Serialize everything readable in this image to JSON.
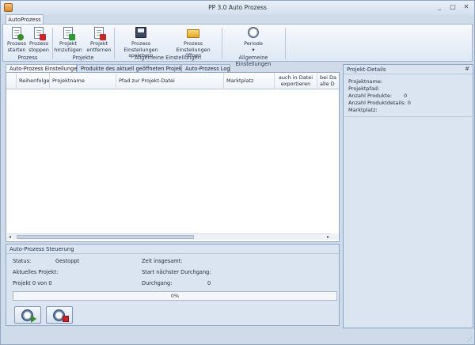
{
  "window": {
    "title": "PP 3.0 Auto Prozess"
  },
  "ribbon": {
    "tab": "AutoProzess",
    "groups": [
      {
        "label": "Prozess",
        "buttons": [
          "Prozess starten",
          "Prozess stoppen"
        ]
      },
      {
        "label": "Projekte",
        "buttons": [
          "Projekt hinzufügen",
          "Projekt entfernen"
        ]
      },
      {
        "label": "Allgemeine Einstellungen",
        "buttons": [
          "Prozess Einstellungen speichern",
          "Prozess Einstellungen öffnen"
        ]
      },
      {
        "label": "Allgemeine Einstellungen",
        "buttons": [
          "Periode"
        ]
      }
    ]
  },
  "tabs": [
    "Auto-Prozess Einstellungen",
    "Produkte des aktuell geöffneten Projekts",
    "Auto-Prozess Log"
  ],
  "grid": {
    "columns": [
      "",
      "Reihenfolge",
      "Projektname",
      "Pfad zur Projekt-Datei",
      "Marktplatz",
      "auch in Datei exportieren",
      "bei Da alle D"
    ]
  },
  "control": {
    "title": "Auto-Prozess Steuerung",
    "status_label": "Status:",
    "status_value": "Gestoppt",
    "current_label": "Aktuelles Projekt:",
    "project_count": "Projekt 0 von 0",
    "total_time_label": "Zeit insgesamt:",
    "next_run_label": "Start nächster Durchgang:",
    "run_label": "Durchgang:",
    "run_value": "0",
    "progress": 0,
    "progress_text": "0%"
  },
  "details": {
    "title": "Projekt-Details",
    "pin": "#",
    "rows": [
      {
        "label": "Projektname:",
        "value": ""
      },
      {
        "label": "Projektpfad:",
        "value": ""
      },
      {
        "label": "Anzahl Produkte:",
        "value": "0"
      },
      {
        "label": "Anzahl Produktdetails:",
        "value": "0"
      },
      {
        "label": "Marktplatz:",
        "value": ""
      }
    ]
  },
  "colors": {
    "accent": "#4a6d94",
    "panel": "#dbe5f1",
    "border": "#8ea5c3"
  },
  "icons": [
    "app-icon",
    "start-process-icon",
    "stop-process-icon",
    "add-project-icon",
    "remove-project-icon",
    "save-settings-icon",
    "open-settings-icon",
    "period-clock-icon"
  ]
}
